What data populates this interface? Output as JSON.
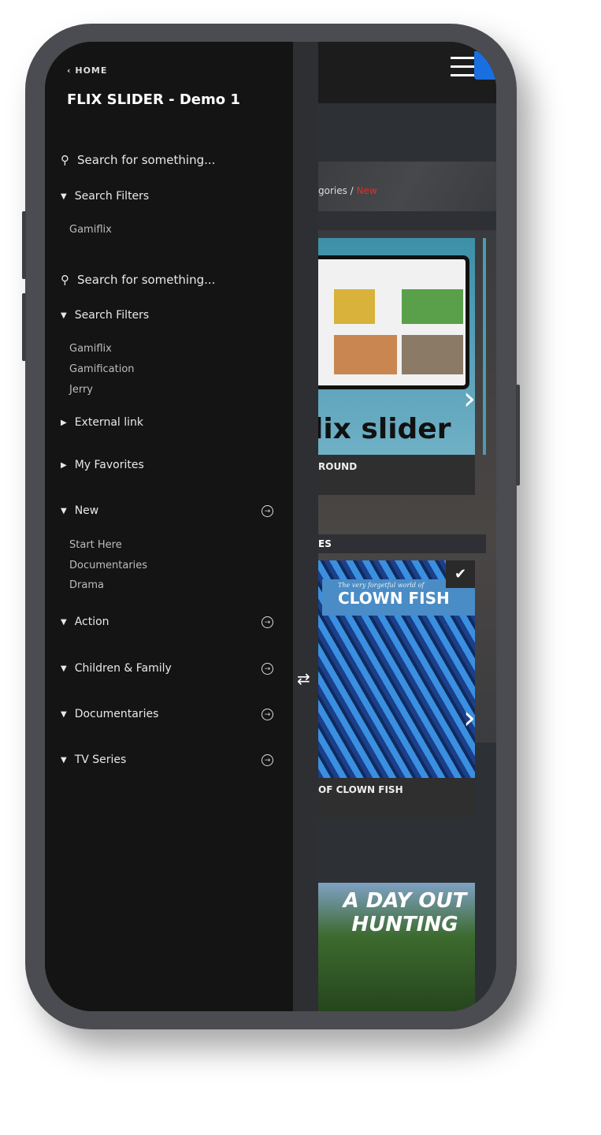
{
  "sidebar": {
    "home_label": "HOME",
    "title": "FLIX SLIDER - Demo 1",
    "search1_placeholder": "Search for something...",
    "filters1_label": "Search Filters",
    "filters1_items": [
      "Gamiflix"
    ],
    "search2_placeholder": "Search for something...",
    "filters2_label": "Search Filters",
    "filters2_items": [
      "Gamiflix",
      "Gamification",
      "Jerry"
    ],
    "external_link": "External link",
    "favorites": "My Favorites",
    "new_label": "New",
    "new_items": [
      "Start Here",
      "Documentaries",
      "Drama"
    ],
    "categories": [
      "Action",
      "Children & Family",
      "Documentaries",
      "TV Series"
    ]
  },
  "content": {
    "breadcrumb_prefix": "gories / ",
    "breadcrumb_current": "New",
    "card1_image_text": "lix slider",
    "card1_caption": "ROUND",
    "section2_label": "ES",
    "card2_tagline": "The very forgetful world of",
    "card2_title": "CLOWN FISH",
    "card2_caption": "OF CLOWN FISH",
    "card3_title": "A DAY OUT HUNTING"
  },
  "colors": {
    "accent_red": "#d9302b",
    "blue": "#1a6fe0",
    "sidebar_bg": "#141414"
  }
}
